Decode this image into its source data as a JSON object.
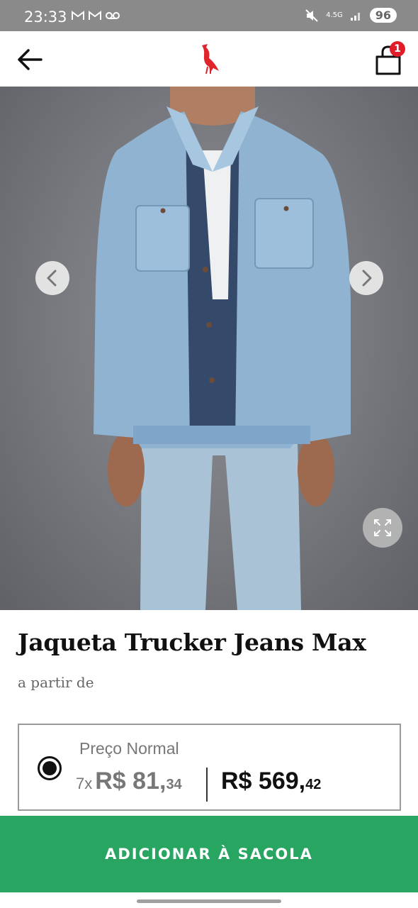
{
  "status_bar": {
    "time": "23:33",
    "network": "4.5G",
    "battery": "96"
  },
  "header": {
    "back_icon": "arrow-left-icon",
    "logo_icon": "brand-bird-icon",
    "cart_icon": "shopping-bag-icon",
    "cart_count": "1"
  },
  "product": {
    "image_alt": "denim-jacket-model-photo",
    "title": "Jaqueta Trucker Jeans Max",
    "price_prefix": "a partir de"
  },
  "price_option": {
    "label": "Preço Normal",
    "installments_count": "7x",
    "installment_value": "R$ 81,",
    "installment_cents": "34",
    "full_value": "R$ 569,",
    "full_cents": "42",
    "selected": true
  },
  "cta": {
    "label": "ADICIONAR À SACOLA"
  },
  "colors": {
    "cta_green": "#27a561",
    "badge_red": "#e11d2a",
    "logo_red": "#e0242c"
  }
}
